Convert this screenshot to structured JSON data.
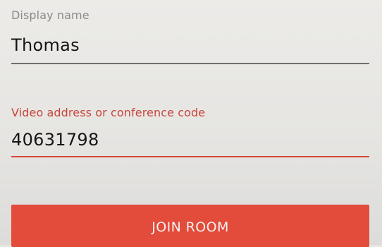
{
  "form": {
    "display_name": {
      "label": "Display name",
      "value": "Thomas"
    },
    "conference_code": {
      "label": "Video address or conference code",
      "value": "40631798"
    },
    "join_button_label": "JOIN ROOM"
  },
  "colors": {
    "accent": "#e34b3a",
    "accent_label": "#c8453a",
    "muted_label": "#8a8a88",
    "background": "#e7e5e2"
  }
}
